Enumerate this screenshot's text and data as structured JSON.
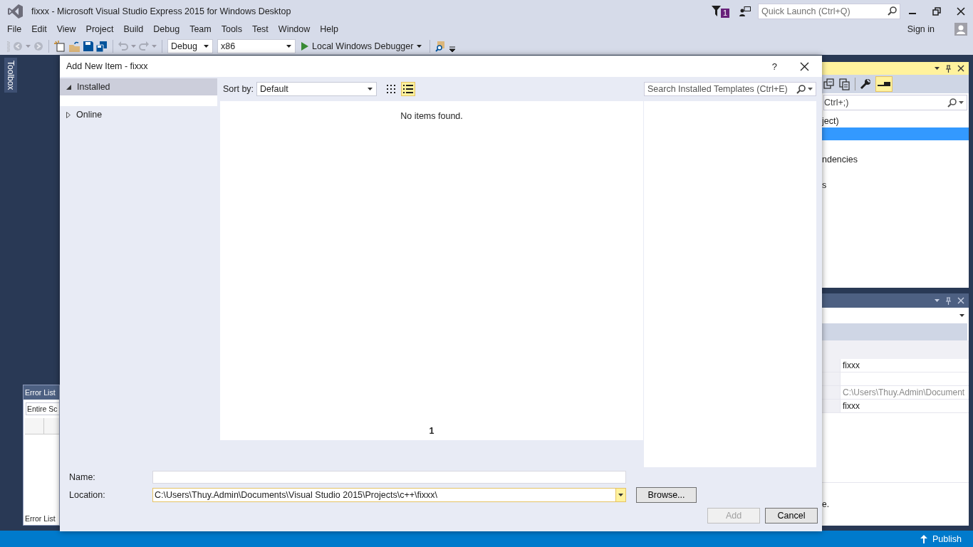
{
  "window": {
    "title": "fixxx - Microsoft Visual Studio Express 2015 for Windows Desktop",
    "notification_count": "1",
    "quick_launch": {
      "placeholder": "Quick Launch (Ctrl+Q)"
    }
  },
  "menu": [
    "File",
    "Edit",
    "View",
    "Project",
    "Build",
    "Debug",
    "Team",
    "Tools",
    "Test",
    "Window",
    "Help"
  ],
  "account": {
    "label": "Sign in"
  },
  "toolbar": {
    "configuration": "Debug",
    "platform": "x86",
    "start": "Local Windows Debugger"
  },
  "toolbox_tab": "Toolbox",
  "error_list": {
    "title": "Error List",
    "scope": "Entire Sc",
    "tab": "Error List"
  },
  "solution_explorer": {
    "search_placeholder": "Ctrl+;)",
    "items": [
      {
        "label": "ject)",
        "selected": false
      },
      {
        "selected": true
      },
      {
        "selected": false
      },
      {
        "label": "ndencies",
        "selected": false
      },
      {
        "selected": false
      },
      {
        "label": "s",
        "selected": false
      }
    ]
  },
  "properties": {
    "rows": [
      {
        "value": "fixxx",
        "disabled": false
      },
      {},
      {
        "value": "C:\\Users\\Thuy.Admin\\Document",
        "disabled": true
      },
      {
        "value": "fixxx",
        "disabled": false
      }
    ],
    "description": "e."
  },
  "dialog": {
    "title": "Add New Item - fixxx",
    "help": "?",
    "categories": [
      {
        "label": "Installed",
        "expanded": true,
        "selected": true
      },
      {
        "label": "Online",
        "expanded": false,
        "selected": false
      }
    ],
    "sort_label": "Sort by:",
    "sort_value": "Default",
    "views": [
      {
        "kind": "grid",
        "selected": false
      },
      {
        "kind": "list",
        "selected": true
      }
    ],
    "search_placeholder": "Search Installed Templates (Ctrl+E)",
    "empty_message": "No items found.",
    "page": "1",
    "name_label": "Name:",
    "location_label": "Location:",
    "location_value": "C:\\Users\\Thuy.Admin\\Documents\\Visual Studio 2015\\Projects\\c++\\fixxx\\",
    "browse": "Browse...",
    "actions": [
      {
        "label": "Add",
        "disabled": true
      },
      {
        "label": "Cancel",
        "disabled": false
      }
    ]
  },
  "status_bar": {
    "publish": "Publish"
  }
}
